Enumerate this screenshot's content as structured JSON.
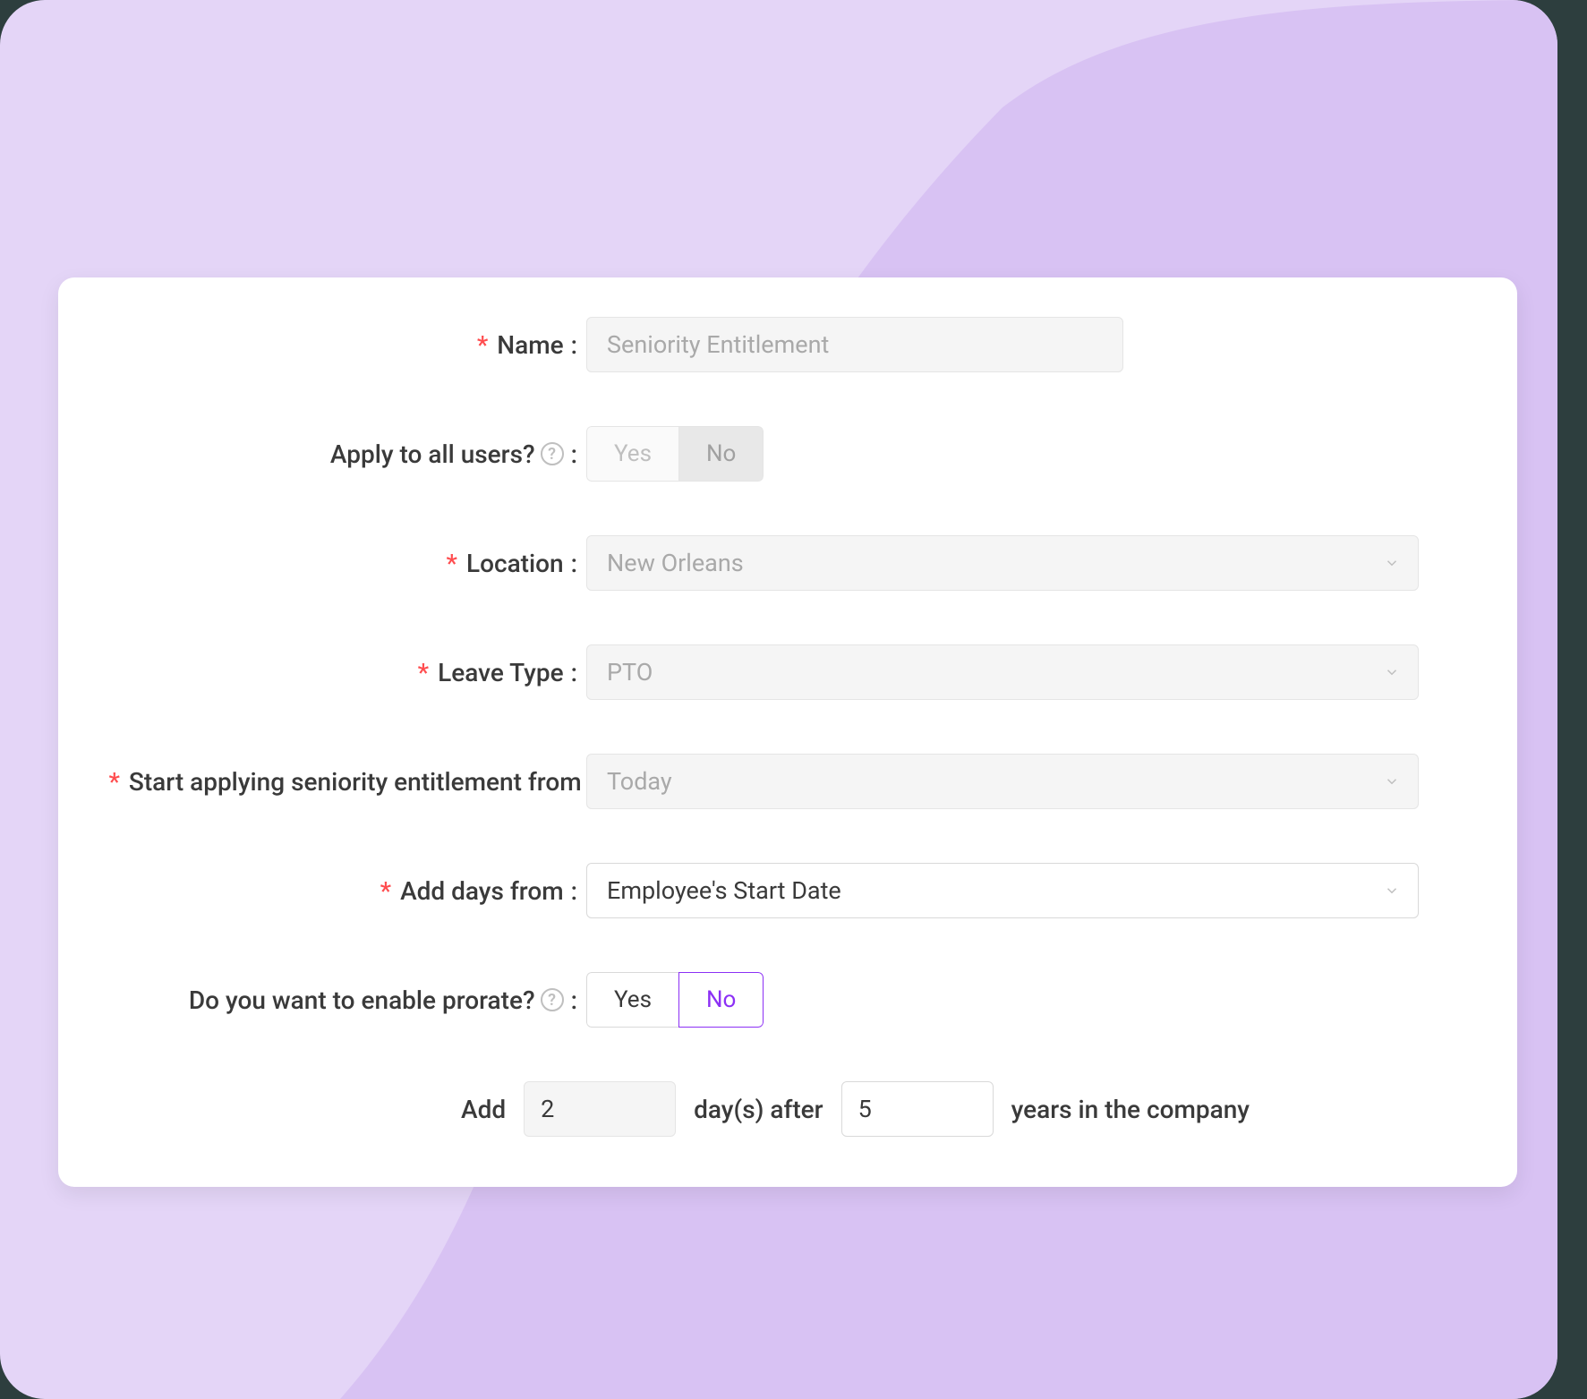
{
  "form": {
    "name": {
      "label": "Name",
      "placeholder": "Seniority Entitlement"
    },
    "applyAll": {
      "label": "Apply to all users?",
      "yes": "Yes",
      "no": "No",
      "selected": "No"
    },
    "location": {
      "label": "Location",
      "value": "New Orleans"
    },
    "leaveType": {
      "label": "Leave Type",
      "value": "PTO"
    },
    "startFrom": {
      "label": "Start applying seniority entitlement from",
      "value": "Today"
    },
    "addFrom": {
      "label": "Add days from",
      "value": "Employee's Start Date"
    },
    "prorate": {
      "label": "Do you want to enable prorate?",
      "yes": "Yes",
      "no": "No",
      "selected": "No"
    },
    "sentence": {
      "add": "Add",
      "days": "2",
      "mid": "day(s) after",
      "years": "5",
      "tail": "years in the company"
    }
  }
}
